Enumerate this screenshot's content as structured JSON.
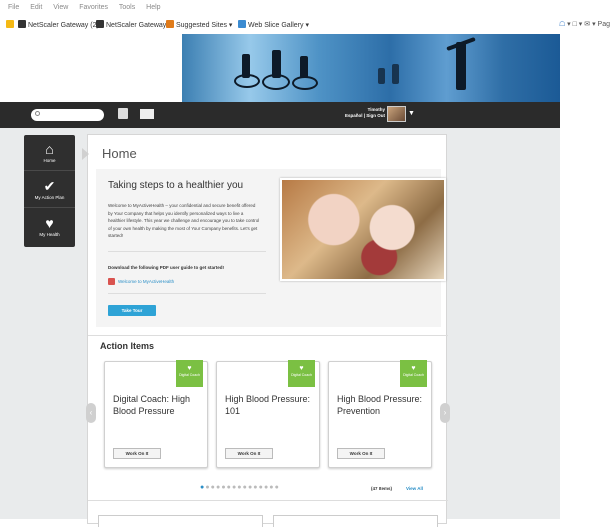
{
  "browser": {
    "menu": [
      "File",
      "Edit",
      "View",
      "Favorites",
      "Tools",
      "Help"
    ],
    "favorites": [
      "NetScaler Gateway (2)",
      "NetScaler Gateway",
      "Suggested Sites ▾",
      "Web Slice Gallery ▾"
    ],
    "tools_text": "▾ □ ▾ ✉ ▾ Pag"
  },
  "navbar": {
    "search_placeholder": "",
    "user_name": "Timothy",
    "user_links": "Español | Sign Out"
  },
  "sidenav": {
    "items": [
      {
        "label": "Home",
        "icon": "home-icon",
        "glyph": "⌂"
      },
      {
        "label": "My Action Plan",
        "icon": "checkmark-icon",
        "glyph": "✔"
      },
      {
        "label": "My Health",
        "icon": "heart-icon",
        "glyph": "♥"
      }
    ]
  },
  "page": {
    "title": "Home",
    "hero": {
      "title": "Taking steps to a healthier you",
      "body": "Welcome to MyActiveHealth – your confidential and secure benefit offered by Your Company that helps you identify personalized ways to live a healthier lifestyle. This year we challenge and encourage you to take control of your own health by making the most of Your Company benefits. Let's get started!",
      "download_heading": "Download the following PDF user guide to get started!",
      "pdf_link": "Welcome to MyActiveHealth",
      "tour_button": "Take Tour"
    },
    "action_items": {
      "title": "Action Items",
      "badge_text": "Digital Coach",
      "cards": [
        {
          "title": "Digital Coach: High Blood Pressure",
          "button": "Work On It"
        },
        {
          "title": "High Blood Pressure: 101",
          "button": "Work On It"
        },
        {
          "title": "High Blood Pressure: Prevention",
          "button": "Work On It"
        }
      ],
      "count_text": "(47 Items)",
      "view_all": "View All",
      "pager_total": 15,
      "pager_active": 1
    }
  },
  "colors": {
    "accent": "#2ea3d6",
    "badge_green": "#7bc043",
    "navbar": "#2b2b2b"
  }
}
